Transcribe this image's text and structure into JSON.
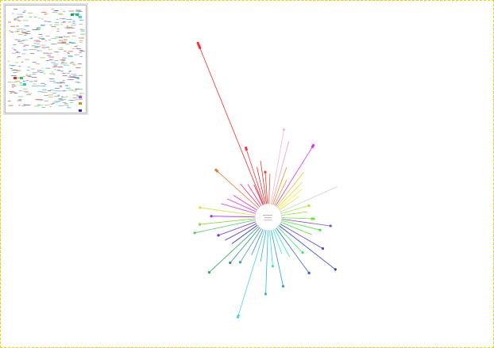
{
  "canvas": {
    "background": "#ffffff",
    "border_color": "#f2d400"
  },
  "overview": {
    "icon": "navigator-minimap"
  },
  "graph": {
    "type": "radial-tree",
    "hub_color": "#cccccc"
  }
}
